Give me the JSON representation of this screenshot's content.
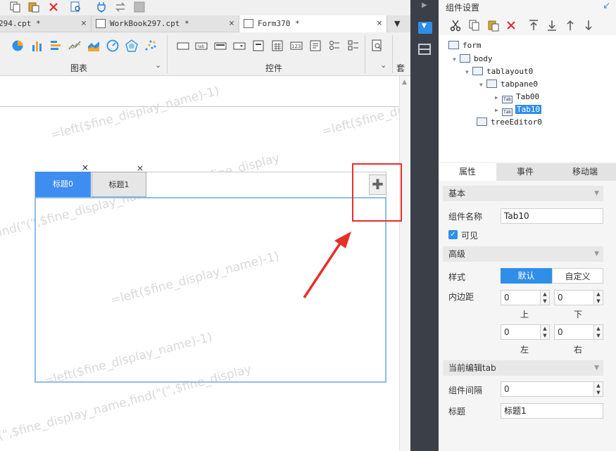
{
  "doc_tabs": [
    {
      "label": "294.cpt *"
    },
    {
      "label": "WorkBook297.cpt *"
    },
    {
      "label": "Form370 *"
    }
  ],
  "ribbon": {
    "chart_label": "图表",
    "widget_label": "控件",
    "preset_label": "套用"
  },
  "watermark": {
    "text_a": "=left($fine_display_name)-1)",
    "text_b": "find(\"(\",$fine_display_name,find(\"(\",$fine_display"
  },
  "tab_widget": {
    "tab0": "标题0",
    "tab1": "标题1"
  },
  "panel": {
    "title": "组件设置",
    "tree": {
      "form": "form",
      "body": "body",
      "tablayout": "tablayout0",
      "tabpane": "tabpane0",
      "tab00": "Tab00",
      "tab10": "Tab10",
      "treeeditor": "treeEditor0"
    },
    "tabs": {
      "props": "属性",
      "events": "事件",
      "mobile": "移动端"
    },
    "basic": "基本",
    "name_label": "组件名称",
    "name_value": "Tab10",
    "visible_label": "可见",
    "advanced": "高级",
    "style_label": "样式",
    "style_default": "默认",
    "style_custom": "自定义",
    "padding_label": "内边距",
    "pad_top": "0",
    "pad_bottom": "0",
    "pad_left": "0",
    "pad_right": "0",
    "pad_top_label": "上",
    "pad_bottom_label": "下",
    "pad_left_label": "左",
    "pad_right_label": "右",
    "current_tab": "当前编辑tab",
    "gap_label": "组件间隔",
    "gap_value": "0",
    "title_label": "标题",
    "title_value": "标题1"
  },
  "colors": {
    "accent": "#2f8fe8",
    "tab_active": "#3d8ef0",
    "highlight_box": "#e5302a"
  }
}
